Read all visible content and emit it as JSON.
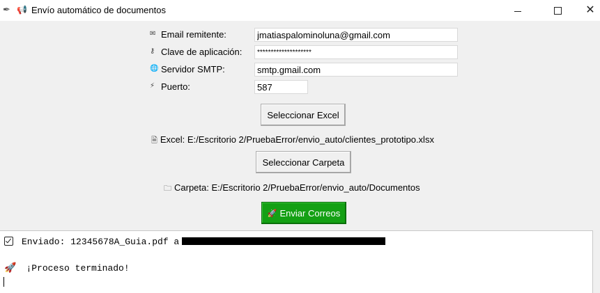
{
  "window": {
    "title": "Envío automático de documentos",
    "app_icon": "feather-icon",
    "title_icon": "megaphone-icon"
  },
  "form": {
    "email": {
      "label": "Email remitente:",
      "icon": "envelope-icon",
      "value": "jmatiaspalominoluna@gmail.com"
    },
    "password": {
      "label": "Clave de aplicación:",
      "icon": "key-icon",
      "value": "********************"
    },
    "smtp": {
      "label": "Servidor SMTP:",
      "icon": "globe-icon",
      "value": "smtp.gmail.com"
    },
    "port": {
      "label": "Puerto:",
      "icon": "plug-icon",
      "value": "587"
    }
  },
  "buttons": {
    "select_excel": "Seleccionar Excel",
    "select_folder": "Seleccionar Carpeta",
    "send": "Enviar Correos",
    "send_color": "#14a014"
  },
  "paths": {
    "excel": "Excel: E:/Escritorio 2/PruebaError/envio_auto/clientes_prototipo.xlsx",
    "folder": "Carpeta: E:/Escritorio 2/PruebaError/envio_auto/Documentos"
  },
  "log": {
    "line1": "Enviado: 12345678A_Guia.pdf a",
    "line2": "¡Proceso terminado!"
  }
}
